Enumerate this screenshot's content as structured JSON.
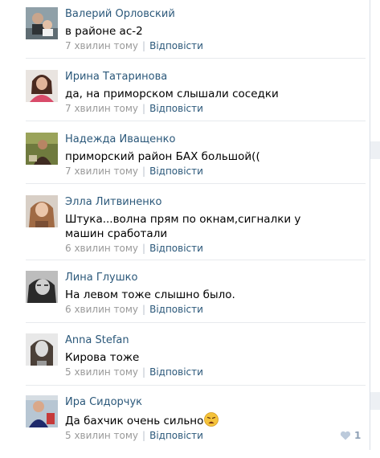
{
  "comments": [
    {
      "author": "Валерий Орловский",
      "text": "в районе ас-2",
      "time": "7 хвилин тому",
      "reply": "Відповісти",
      "avatar": "avatar-photo"
    },
    {
      "author": "Ирина Татаринова",
      "text": "да, на приморском слышали соседки",
      "time": "7 хвилин тому",
      "reply": "Відповісти",
      "avatar": "avatar-photo"
    },
    {
      "author": "Надежда Иващенко",
      "text": "приморский район БАХ большой((",
      "time": "7 хвилин тому",
      "reply": "Відповісти",
      "avatar": "avatar-photo"
    },
    {
      "author": "Элла Литвиненко",
      "text": "Штука...волна прям по окнам,сигналки у машин сработали",
      "time": "6 хвилин тому",
      "reply": "Відповісти",
      "avatar": "avatar-photo"
    },
    {
      "author": "Лина Глушко",
      "text": "На левом тоже слышно было.",
      "time": "6 хвилин тому",
      "reply": "Відповісти",
      "avatar": "avatar-photo"
    },
    {
      "author": "Anna Stefan",
      "text": "Кирова тоже",
      "time": "5 хвилин тому",
      "reply": "Відповісти",
      "avatar": "avatar-photo"
    },
    {
      "author": "Ира Сидорчук",
      "text": "Да бахчик очень сильно",
      "time": "5 хвилин тому",
      "reply": "Відповісти",
      "avatar": "avatar-photo",
      "emoji": "weary-face-emoji",
      "likes": "1"
    }
  ],
  "separator": "|",
  "colors": {
    "link": "#2b587a",
    "meta": "#999999",
    "divider": "#e7eaed",
    "like": "#8fa1b6"
  }
}
